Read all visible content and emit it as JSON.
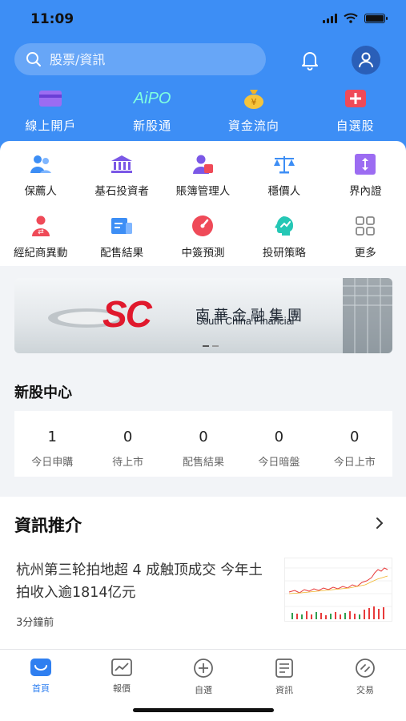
{
  "status": {
    "time": "11:09"
  },
  "search": {
    "placeholder": "股票/資訊"
  },
  "top_actions": [
    {
      "label": "線上開戶",
      "icon": "card-icon"
    },
    {
      "label": "新股通",
      "icon": "aipo-logo"
    },
    {
      "label": "資金流向",
      "icon": "money-bag-icon"
    },
    {
      "label": "自選股",
      "icon": "plus-icon"
    }
  ],
  "aipo_logo_text": "AiPO",
  "grid_row1": [
    {
      "label": "保薦人",
      "icon": "people-icon"
    },
    {
      "label": "基石投資者",
      "icon": "bank-icon"
    },
    {
      "label": "賬簿管理人",
      "icon": "manager-icon"
    },
    {
      "label": "穩價人",
      "icon": "scale-icon"
    },
    {
      "label": "界內證",
      "icon": "range-icon"
    }
  ],
  "grid_row2": [
    {
      "label": "經紀商異動",
      "icon": "broker-icon"
    },
    {
      "label": "配售結果",
      "icon": "document-icon"
    },
    {
      "label": "中簽預測",
      "icon": "gauge-icon"
    },
    {
      "label": "投研策略",
      "icon": "brain-icon"
    },
    {
      "label": "更多",
      "icon": "grid-icon"
    }
  ],
  "banner": {
    "logo_text": "SC",
    "chinese_name": "南華金融集團",
    "english_name": "South China Financial"
  },
  "ipo_center": {
    "title": "新股中心",
    "items": [
      {
        "value": "1",
        "label": "今日申購"
      },
      {
        "value": "0",
        "label": "待上市"
      },
      {
        "value": "0",
        "label": "配售結果"
      },
      {
        "value": "0",
        "label": "今日暗盤"
      },
      {
        "value": "0",
        "label": "今日上市"
      }
    ]
  },
  "news": {
    "title": "資訊推介",
    "headline": "杭州第三轮拍地超 4 成触顶成交 今年土拍收入逾1814亿元",
    "time": "3分鐘前"
  },
  "tabs": [
    {
      "label": "首頁",
      "icon": "home-icon",
      "active": true
    },
    {
      "label": "報價",
      "icon": "chart-icon",
      "active": false
    },
    {
      "label": "自選",
      "icon": "add-circle-icon",
      "active": false
    },
    {
      "label": "資訊",
      "icon": "news-icon",
      "active": false
    },
    {
      "label": "交易",
      "icon": "trade-icon",
      "active": false
    }
  ],
  "colors": {
    "brand_blue": "#3d8ef5",
    "accent_purple": "#7b58e6",
    "accent_red": "#e9434f",
    "active_tab": "#2f7ff0"
  }
}
